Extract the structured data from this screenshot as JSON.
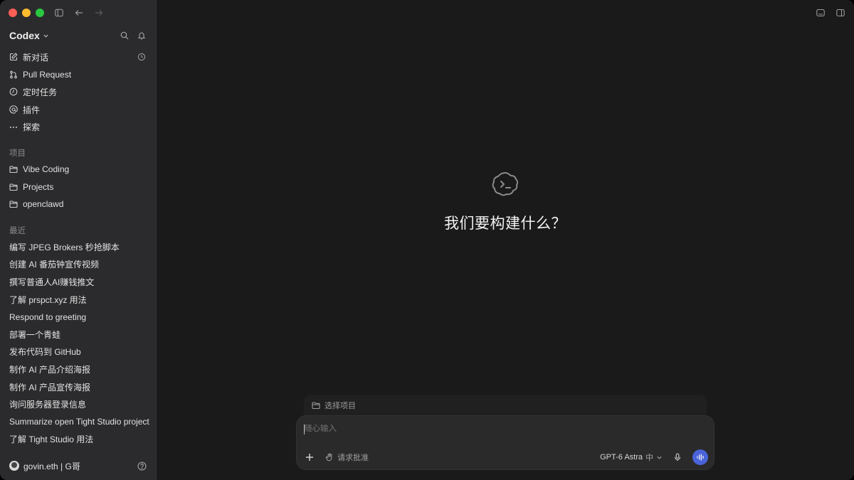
{
  "app": {
    "name": "Codex"
  },
  "sidebar": {
    "nav": [
      {
        "label": "新对话",
        "icon": "edit-icon"
      },
      {
        "label": "Pull Request",
        "icon": "pull-request-icon"
      },
      {
        "label": "定时任务",
        "icon": "clock-icon"
      },
      {
        "label": "插件",
        "icon": "at-icon"
      },
      {
        "label": "探索",
        "icon": "ellipsis-icon"
      }
    ],
    "projects_label": "项目",
    "projects": [
      {
        "label": "Vibe Coding"
      },
      {
        "label": "Projects"
      },
      {
        "label": "openclawd"
      }
    ],
    "recent_label": "最近",
    "recent": [
      {
        "label": "编写 JPEG Brokers 秒抢脚本"
      },
      {
        "label": "创建 AI 番茄钟宣传视频"
      },
      {
        "label": "撰写普通人AI赚钱推文"
      },
      {
        "label": "了解 prspct.xyz 用法"
      },
      {
        "label": "Respond to greeting"
      },
      {
        "label": "部署一个青蛙"
      },
      {
        "label": "发布代码到 GitHub"
      },
      {
        "label": "制作 AI 产品介绍海报"
      },
      {
        "label": "制作 AI 产品宣传海报"
      },
      {
        "label": "询问服务器登录信息"
      },
      {
        "label": "Summarize open Tight Studio project"
      },
      {
        "label": "了解 Tight Studio 用法"
      }
    ],
    "user": {
      "name": "govin.eth | G哥"
    }
  },
  "main": {
    "hero_title": "我们要构建什么？",
    "project_selector": "选择项目",
    "composer": {
      "placeholder": "随心输入",
      "approve_label": "请求批准",
      "model": "GPT-6 Astra",
      "effort": "中"
    }
  },
  "colors": {
    "accent": "#4a63d8",
    "sidebar_bg": "#2b2b2d",
    "main_bg": "#1a1a1a"
  }
}
